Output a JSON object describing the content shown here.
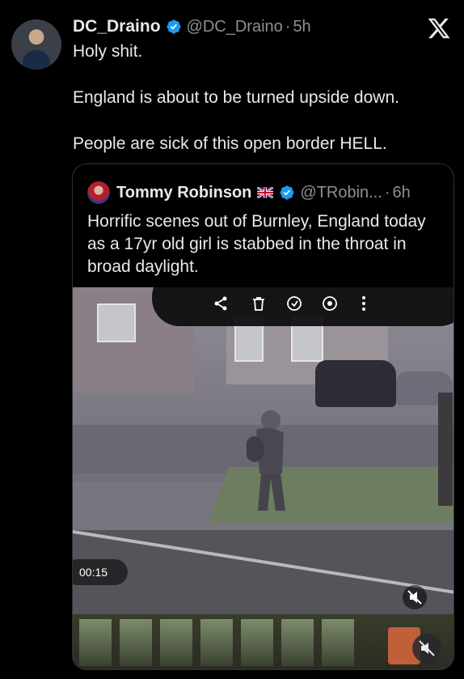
{
  "tweet": {
    "author_name": "DC_Draino",
    "author_handle": "@DC_Draino",
    "separator": "·",
    "time": "5h",
    "lines": [
      "Holy shit.",
      "England is about to be turned upside down.",
      "People are sick of this open border HELL."
    ]
  },
  "quote": {
    "author_name": "Tommy Robinson",
    "author_handle": "@TRobin...",
    "separator": "·",
    "time": "6h",
    "text": "Horrific scenes out of Burnley, England today as a 17yr old girl is stabbed in the throat in broad daylight.",
    "video": {
      "duration": "00:15"
    }
  },
  "icons": {
    "verified": "verified-badge-icon",
    "x_logo": "x-logo-icon",
    "flag": "union-jack-flag-icon",
    "mute": "mute-icon"
  },
  "colors": {
    "background": "#000000",
    "text": "#e7e9ea",
    "secondary": "#8b9096",
    "verified": "#1d9bf0",
    "border": "#2f3336"
  }
}
